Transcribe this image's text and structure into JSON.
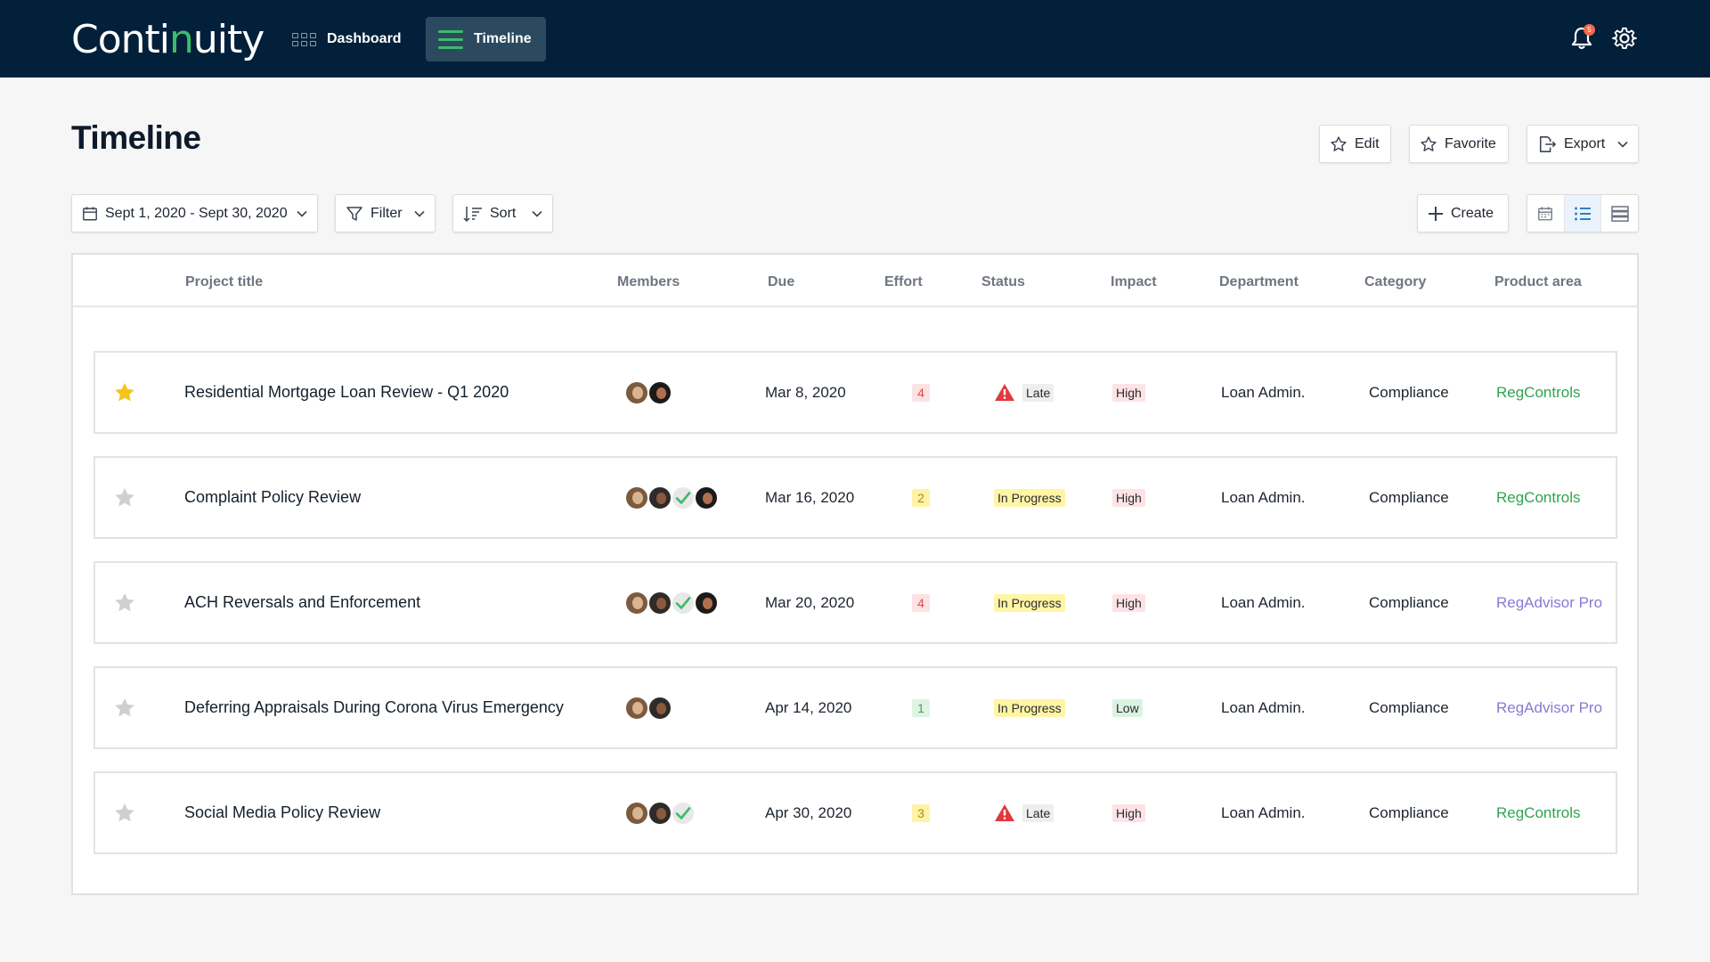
{
  "app": {
    "logo_prefix": "Conti",
    "logo_u": "n",
    "logo_suffix": "uity",
    "notification_count": "5"
  },
  "nav": {
    "dashboard_label": "Dashboard",
    "timeline_label": "Timeline"
  },
  "page": {
    "title": "Timeline"
  },
  "actions": {
    "edit_label": "Edit",
    "favorite_label": "Favorite",
    "export_label": "Export",
    "create_label": "Create"
  },
  "toolbar": {
    "date_range": "Sept 1, 2020 - Sept 30, 2020",
    "filter_label": "Filter",
    "sort_label": "Sort"
  },
  "columns": [
    "Project title",
    "Members",
    "Due",
    "Effort",
    "Status",
    "Impact",
    "Department",
    "Category",
    "Product area"
  ],
  "rows": [
    {
      "starred": true,
      "title": "Residential Mortgage Loan Review - Q1 2020",
      "members": [
        "a",
        "d"
      ],
      "due": "Mar 8, 2020",
      "effort": "4",
      "effort_color": "red",
      "status": "Late",
      "status_type": "late",
      "impact": "High",
      "department": "Loan Admin.",
      "category": "Compliance",
      "product_area": "RegControls",
      "product_color": "green"
    },
    {
      "starred": false,
      "title": "Complaint Policy Review",
      "members": [
        "a",
        "b",
        "c",
        "d"
      ],
      "due": "Mar 16, 2020",
      "effort": "2",
      "effort_color": "yellow",
      "status": "In Progress",
      "status_type": "progress",
      "impact": "High",
      "department": "Loan Admin.",
      "category": "Compliance",
      "product_area": "RegControls",
      "product_color": "green"
    },
    {
      "starred": false,
      "title": "ACH Reversals and Enforcement",
      "members": [
        "a",
        "b",
        "c",
        "d"
      ],
      "due": "Mar 20, 2020",
      "effort": "4",
      "effort_color": "red",
      "status": "In Progress",
      "status_type": "progress",
      "impact": "High",
      "department": "Loan Admin.",
      "category": "Compliance",
      "product_area": "RegAdvisor Pro",
      "product_color": "purple"
    },
    {
      "starred": false,
      "title": "Deferring Appraisals During Corona Virus Emergency",
      "members": [
        "a",
        "b"
      ],
      "due": "Apr 14, 2020",
      "effort": "1",
      "effort_color": "green",
      "status": "In Progress",
      "status_type": "progress",
      "impact": "Low",
      "department": "Loan Admin.",
      "category": "Compliance",
      "product_area": "RegAdvisor Pro",
      "product_color": "purple"
    },
    {
      "starred": false,
      "title": "Social Media Policy Review",
      "members": [
        "a",
        "b",
        "c"
      ],
      "due": "Apr 30, 2020",
      "effort": "3",
      "effort_color": "yellow",
      "status": "Late",
      "status_type": "late",
      "impact": "High",
      "department": "Loan Admin.",
      "category": "Compliance",
      "product_area": "RegControls",
      "product_color": "green"
    }
  ],
  "colors": {
    "nav_bg": "#03203a",
    "accent_green": "#3dbb6b",
    "star_active": "#f4c51b",
    "star_inactive": "#cfcfcf",
    "late_red": "#e0393e"
  }
}
